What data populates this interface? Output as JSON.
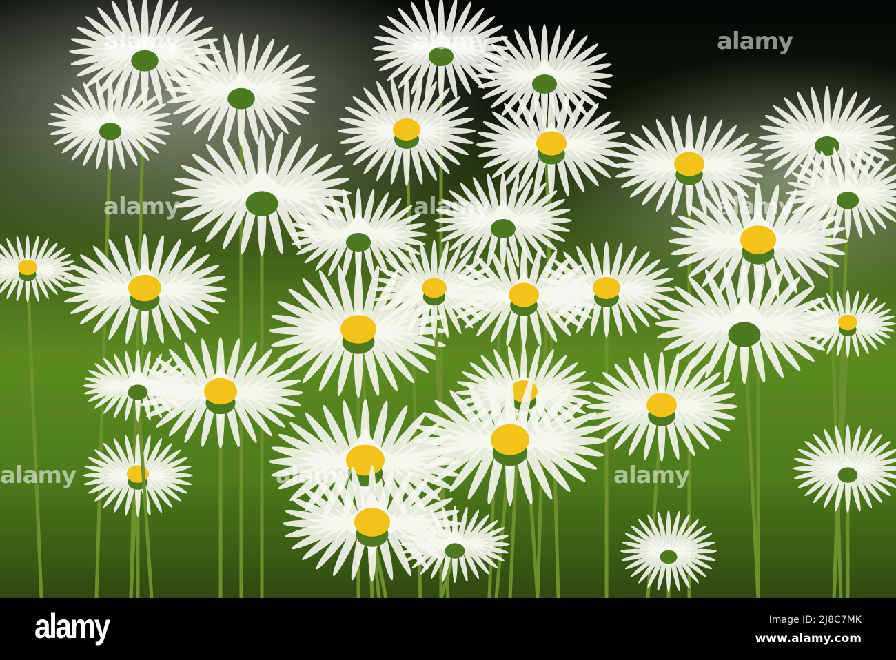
{
  "photo": {
    "subject": "daisies",
    "colors": {
      "petal": "#f6f7f0",
      "center": "#f2c41a",
      "stem": "#6e8f2e",
      "background_top": "#050805",
      "background_grass": "#5e8a22"
    }
  },
  "watermark": {
    "text": "alamy"
  },
  "footer": {
    "logo": "alamy",
    "image_id": "Image ID: 2J8C7MK",
    "website": "www.alamy.com"
  }
}
